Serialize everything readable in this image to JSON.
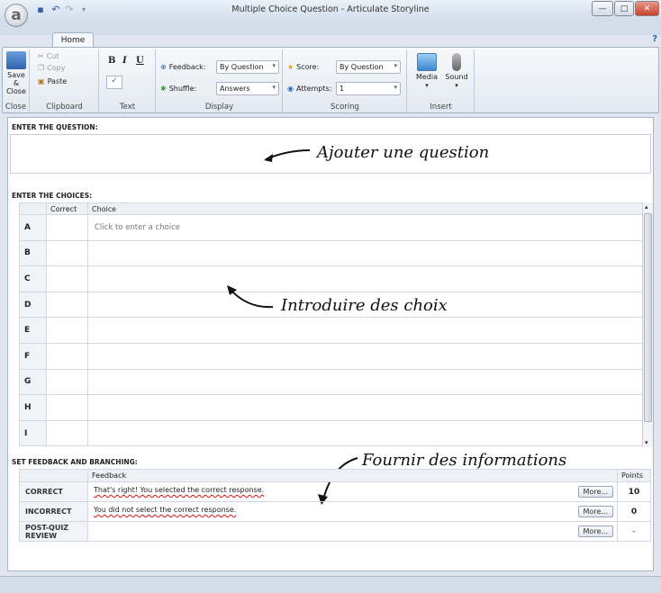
{
  "window": {
    "title": "Multiple Choice Question - Articulate Storyline",
    "app_logo": "a",
    "minimize": "—",
    "maximize": "□",
    "close": "✕"
  },
  "ribbon": {
    "tab": "Home",
    "help": "?",
    "close_group": {
      "label": "Close",
      "save_close_label": "Save &\nClose"
    },
    "clipboard_group": {
      "label": "Clipboard",
      "cut": "Cut",
      "copy": "Copy",
      "paste": "Paste"
    },
    "text_group": {
      "label": "Text",
      "bold": "B",
      "italic": "I",
      "underline": "U"
    },
    "display_group": {
      "label": "Display",
      "feedback_label": "Feedback:",
      "feedback_value": "By Question",
      "shuffle_label": "Shuffle:",
      "shuffle_value": "Answers"
    },
    "scoring_group": {
      "label": "Scoring",
      "score_label": "Score:",
      "score_value": "By Question",
      "attempts_label": "Attempts:",
      "attempts_value": "1"
    },
    "insert_group": {
      "label": "Insert",
      "media": "Media",
      "sound": "Sound"
    }
  },
  "question": {
    "section_label": "ENTER THE QUESTION:",
    "annotation": "Ajouter une question"
  },
  "choices": {
    "section_label": "ENTER THE CHOICES:",
    "col_correct": "Correct",
    "col_choice": "Choice",
    "rows": [
      {
        "letter": "A",
        "text": "Click to enter a choice"
      },
      {
        "letter": "B",
        "text": ""
      },
      {
        "letter": "C",
        "text": ""
      },
      {
        "letter": "D",
        "text": ""
      },
      {
        "letter": "E",
        "text": ""
      },
      {
        "letter": "F",
        "text": ""
      },
      {
        "letter": "G",
        "text": ""
      },
      {
        "letter": "H",
        "text": ""
      },
      {
        "letter": "I",
        "text": ""
      }
    ],
    "annotation": "Introduire des choix"
  },
  "feedback": {
    "section_label": "SET FEEDBACK AND BRANCHING:",
    "col_feedback": "Feedback",
    "col_points": "Points",
    "annotation": "Fournir des informations",
    "more_label": "More...",
    "rows": [
      {
        "label": "CORRECT",
        "text": "That's right!  You selected the correct response.",
        "points": "10"
      },
      {
        "label": "INCORRECT",
        "text": "You did not select the correct response.",
        "points": "0"
      },
      {
        "label": "POST-QUIZ REVIEW",
        "text": "",
        "points": "-"
      }
    ]
  },
  "colors": {
    "ribbon_border": "#a2b1c5",
    "accent_blue": "#2a6cc2",
    "background": "#dfe6ef"
  }
}
